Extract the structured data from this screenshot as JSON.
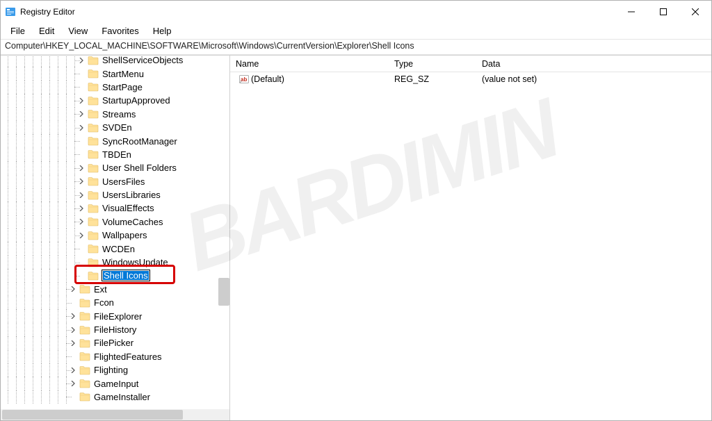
{
  "window": {
    "title": "Registry Editor"
  },
  "menu": {
    "file": "File",
    "edit": "Edit",
    "view": "View",
    "favorites": "Favorites",
    "help": "Help"
  },
  "address": "Computer\\HKEY_LOCAL_MACHINE\\SOFTWARE\\Microsoft\\Windows\\CurrentVersion\\Explorer\\Shell Icons",
  "tree": [
    {
      "label": "ShellServiceObjects",
      "expander": "closed",
      "depth": 9
    },
    {
      "label": "StartMenu",
      "expander": "none",
      "depth": 9
    },
    {
      "label": "StartPage",
      "expander": "none",
      "depth": 9
    },
    {
      "label": "StartupApproved",
      "expander": "closed",
      "depth": 9
    },
    {
      "label": "Streams",
      "expander": "closed",
      "depth": 9
    },
    {
      "label": "SVDEn",
      "expander": "closed",
      "depth": 9
    },
    {
      "label": "SyncRootManager",
      "expander": "none",
      "depth": 9
    },
    {
      "label": "TBDEn",
      "expander": "none",
      "depth": 9
    },
    {
      "label": "User Shell Folders",
      "expander": "closed",
      "depth": 9
    },
    {
      "label": "UsersFiles",
      "expander": "closed",
      "depth": 9
    },
    {
      "label": "UsersLibraries",
      "expander": "closed",
      "depth": 9
    },
    {
      "label": "VisualEffects",
      "expander": "closed",
      "depth": 9
    },
    {
      "label": "VolumeCaches",
      "expander": "closed",
      "depth": 9
    },
    {
      "label": "Wallpapers",
      "expander": "closed",
      "depth": 9
    },
    {
      "label": "WCDEn",
      "expander": "none",
      "depth": 9
    },
    {
      "label": "WindowsUpdate",
      "expander": "none",
      "depth": 9
    },
    {
      "label": "Shell Icons",
      "expander": "none",
      "depth": 9,
      "editing": true,
      "highlight": true
    },
    {
      "label": "Ext",
      "expander": "closed",
      "depth": 8
    },
    {
      "label": "Fcon",
      "expander": "none",
      "depth": 8
    },
    {
      "label": "FileExplorer",
      "expander": "closed",
      "depth": 8
    },
    {
      "label": "FileHistory",
      "expander": "closed",
      "depth": 8
    },
    {
      "label": "FilePicker",
      "expander": "closed",
      "depth": 8
    },
    {
      "label": "FlightedFeatures",
      "expander": "none",
      "depth": 8
    },
    {
      "label": "Flighting",
      "expander": "closed",
      "depth": 8
    },
    {
      "label": "GameInput",
      "expander": "closed",
      "depth": 8
    },
    {
      "label": "GameInstaller",
      "expander": "none",
      "depth": 8
    }
  ],
  "columns": {
    "name": "Name",
    "type": "Type",
    "data": "Data"
  },
  "values": [
    {
      "name": "(Default)",
      "type": "REG_SZ",
      "data": "(value not set)"
    }
  ],
  "watermark": "BARDIMIN"
}
